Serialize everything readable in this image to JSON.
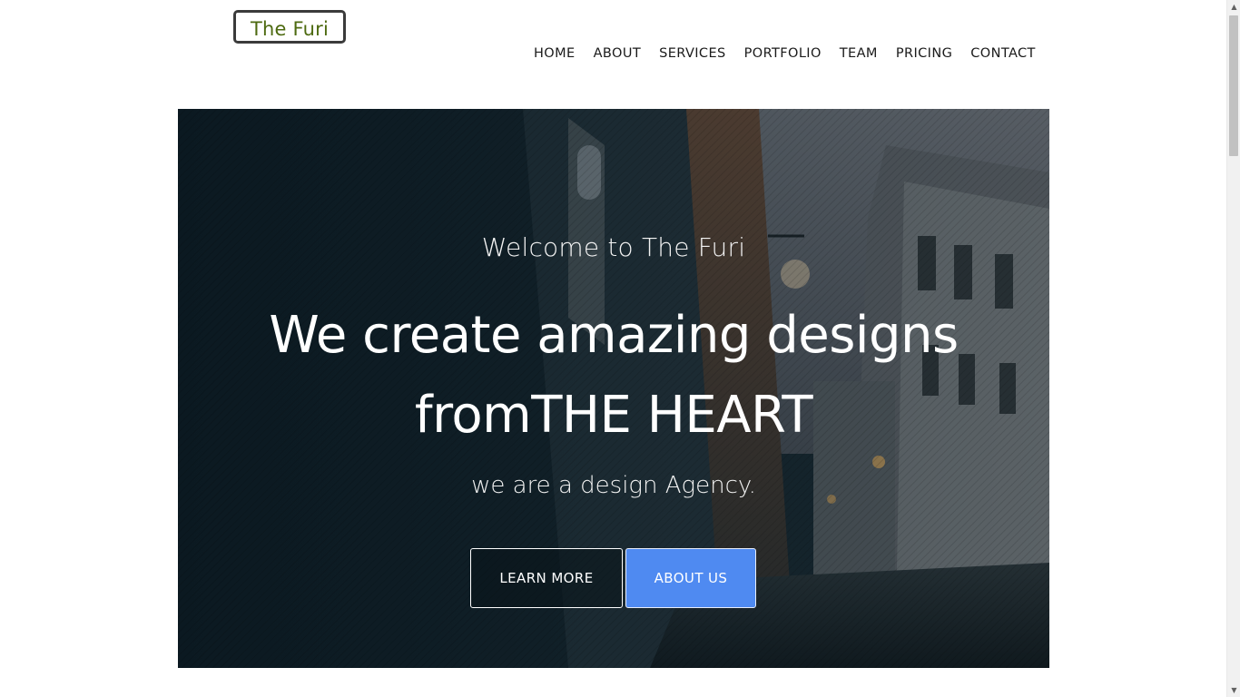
{
  "header": {
    "logo_text": "The Furi",
    "nav": [
      {
        "label": "HOME"
      },
      {
        "label": "ABOUT"
      },
      {
        "label": "SERVICES"
      },
      {
        "label": "PORTFOLIO"
      },
      {
        "label": "TEAM"
      },
      {
        "label": "PRICING"
      },
      {
        "label": "CONTACT"
      }
    ]
  },
  "hero": {
    "welcome": "Welcome to The Furi",
    "headline_line1": "We create amazing designs",
    "headline_line2": "fromTHE HEART",
    "tagline": "we are a design Agency.",
    "learn_more_label": "LEARN MORE",
    "about_us_label": "ABOUT US"
  },
  "colors": {
    "logo_text": "#4d6a10",
    "accent_button": "#4f8af1",
    "hero_overlay": "#1c2e38"
  },
  "icons": {
    "scroll_up": "triangle-up-icon",
    "scroll_down": "triangle-down-icon"
  }
}
